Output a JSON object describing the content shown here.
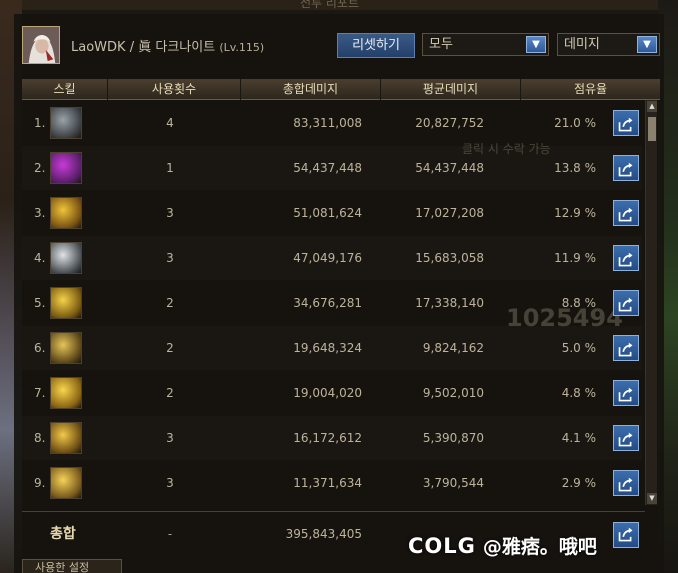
{
  "window": {
    "title": "전투 리포트"
  },
  "character": {
    "name": "LaoWDK",
    "separator": "/",
    "class": "眞 다크나이트",
    "level": "(Lv.115)"
  },
  "controls": {
    "reset_label": "리셋하기",
    "filter_value": "모두",
    "sort_value": "데미지"
  },
  "table": {
    "headers": [
      "스킬",
      "사용횟수",
      "총합데미지",
      "평균데미지",
      "점유율"
    ],
    "rows": [
      {
        "rank": "1.",
        "icon": "skill-icon-1",
        "uses": "4",
        "total": "83,311,008",
        "avg": "20,827,752",
        "share": "21.0 %"
      },
      {
        "rank": "2.",
        "icon": "skill-icon-2",
        "uses": "1",
        "total": "54,437,448",
        "avg": "54,437,448",
        "share": "13.8 %"
      },
      {
        "rank": "3.",
        "icon": "skill-icon-3",
        "uses": "3",
        "total": "51,081,624",
        "avg": "17,027,208",
        "share": "12.9 %"
      },
      {
        "rank": "4.",
        "icon": "skill-icon-4",
        "uses": "3",
        "total": "47,049,176",
        "avg": "15,683,058",
        "share": "11.9 %"
      },
      {
        "rank": "5.",
        "icon": "skill-icon-5",
        "uses": "2",
        "total": "34,676,281",
        "avg": "17,338,140",
        "share": "8.8 %"
      },
      {
        "rank": "6.",
        "icon": "skill-icon-6",
        "uses": "2",
        "total": "19,648,324",
        "avg": "9,824,162",
        "share": "5.0 %"
      },
      {
        "rank": "7.",
        "icon": "skill-icon-7",
        "uses": "2",
        "total": "19,004,020",
        "avg": "9,502,010",
        "share": "4.8 %"
      },
      {
        "rank": "8.",
        "icon": "skill-icon-8",
        "uses": "3",
        "total": "16,172,612",
        "avg": "5,390,870",
        "share": "4.1 %"
      },
      {
        "rank": "9.",
        "icon": "skill-icon-9",
        "uses": "3",
        "total": "11,371,634",
        "avg": "3,790,544",
        "share": "2.9 %"
      }
    ]
  },
  "totals": {
    "label": "총합",
    "uses": "-",
    "total": "395,843,405"
  },
  "bottom_tab": {
    "label": "사용한 설정"
  },
  "background": {
    "ghost_line_1": "클릭 시 수락 가능",
    "ghost_number": "1025494"
  },
  "watermark": {
    "brand": "COLG",
    "handle": "@雅痞。哦吧"
  },
  "colors": {
    "accent_blue": "#2e5a98",
    "header_gold": "#e9ddb8",
    "panel_bg": "#16130f"
  }
}
